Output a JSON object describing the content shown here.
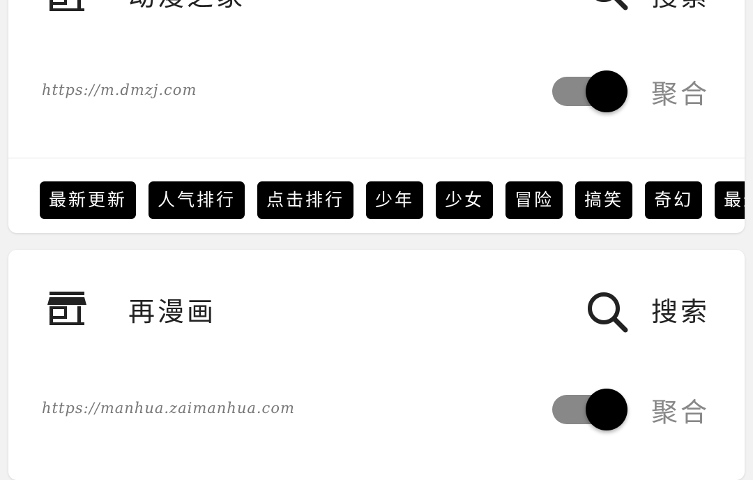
{
  "sources": [
    {
      "title": "动漫之家",
      "search_label": "搜索",
      "url": "https://m.dmzj.com",
      "aggregate_label": "聚合",
      "aggregate_enabled": true,
      "categories": [
        "最新更新",
        "人气排行",
        "点击排行",
        "少年",
        "少女",
        "冒险",
        "搞笑",
        "奇幻",
        "最近"
      ]
    },
    {
      "title": "再漫画",
      "search_label": "搜索",
      "url": "https://manhua.zaimanhua.com",
      "aggregate_label": "聚合",
      "aggregate_enabled": true
    }
  ],
  "icons": {
    "source": "storefront-icon",
    "search": "search-icon"
  },
  "colors": {
    "chip_bg": "#000000",
    "chip_text": "#ffffff",
    "toggle_track": "#888888",
    "toggle_thumb": "#000000"
  }
}
